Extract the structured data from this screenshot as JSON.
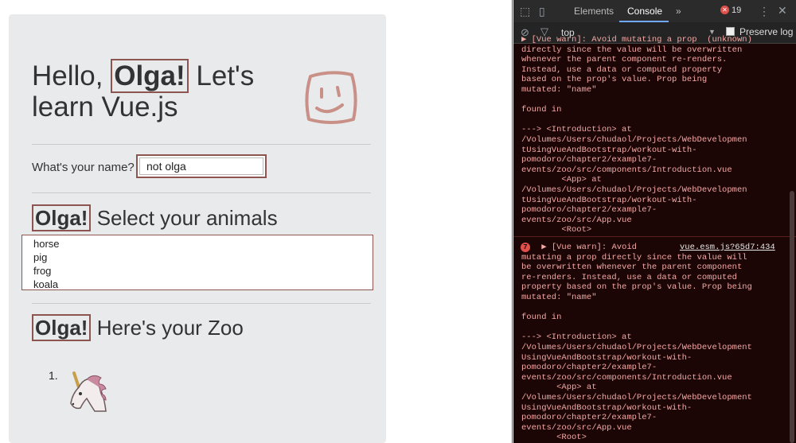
{
  "app": {
    "greeting_before": "Hello, ",
    "name": "Olga!",
    "greeting_after": " Let's learn Vue.js",
    "question": "What's your name?",
    "name_input_value": "not olga",
    "animals_heading": "Select your animals",
    "animals": [
      "horse",
      "pig",
      "frog",
      "koala"
    ],
    "zoo_heading": "Here's your Zoo",
    "zoo_items": [
      "1."
    ],
    "accent_color": "#8e5550"
  },
  "devtools": {
    "tabs": [
      "Elements",
      "Console"
    ],
    "active_tab": "Console",
    "more_tabs_label": "»",
    "error_count": "19",
    "context": "top",
    "preserve_log_label": "Preserve log",
    "messages": [
      {
        "text": "▶ [Vue warn]: Avoid mutating a prop  (unknown)\ndirectly since the value will be overwritten\nwhenever the parent component re-renders.\nInstead, use a data or computed property\nbased on the prop's value. Prop being\nmutated: \"name\"\n\nfound in\n\n---> <Introduction> at\n/Volumes/Users/chudaol/Projects/WebDevelopmen\ntUsingVueAndBootstrap/workout-with-\npomodoro/chapter2/example7-\nevents/zoo/src/components/Introduction.vue\n        <App> at\n/Volumes/Users/chudaol/Projects/WebDevelopmen\ntUsingVueAndBootstrap/workout-with-\npomodoro/chapter2/example7-\nevents/zoo/src/App.vue\n        <Root>"
      },
      {
        "count": "7",
        "source": "vue.esm.js?65d7:434",
        "text": "    ▶ [Vue warn]: Avoid\nmutating a prop directly since the value will\nbe overwritten whenever the parent component\nre-renders. Instead, use a data or computed\nproperty based on the prop's value. Prop being\nmutated: \"name\"\n\nfound in\n\n---> <Introduction> at\n/Volumes/Users/chudaol/Projects/WebDevelopment\nUsingVueAndBootstrap/workout-with-\npomodoro/chapter2/example7-\nevents/zoo/src/components/Introduction.vue\n       <App> at\n/Volumes/Users/chudaol/Projects/WebDevelopment\nUsingVueAndBootstrap/workout-with-\npomodoro/chapter2/example7-\nevents/zoo/src/App.vue\n       <Root>"
      }
    ]
  }
}
